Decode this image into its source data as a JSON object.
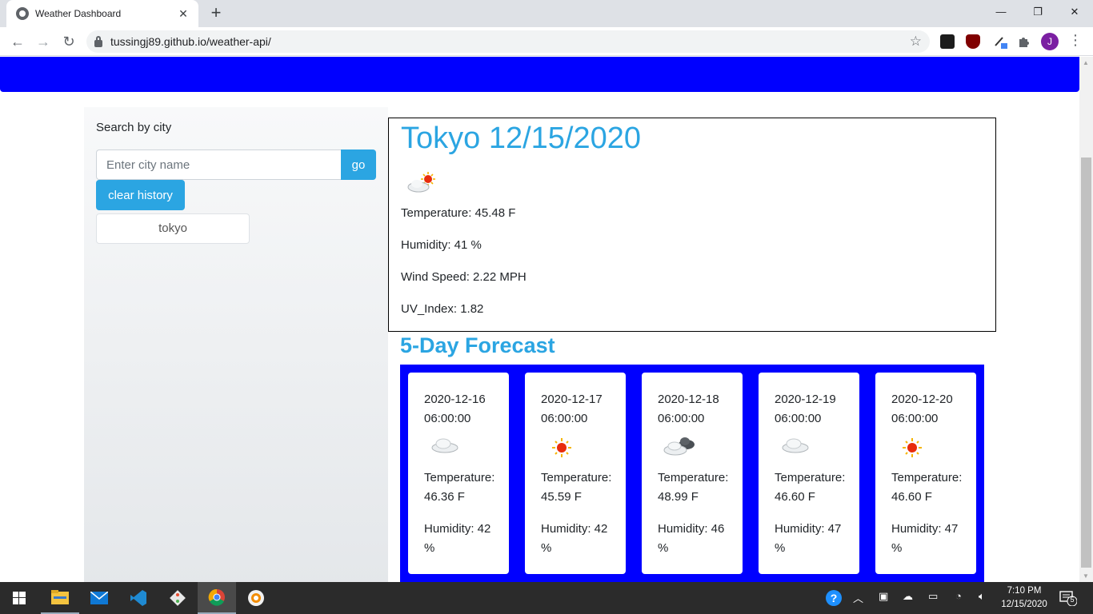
{
  "browser": {
    "tab_title": "Weather Dashboard",
    "url": "tussingj89.github.io/weather-api/",
    "profile_initial": "J"
  },
  "sidebar": {
    "search_label": "Search by city",
    "input_placeholder": "Enter city name",
    "input_value": "",
    "go_label": "go",
    "clear_label": "clear history",
    "history": [
      "tokyo"
    ]
  },
  "current": {
    "title": "Tokyo 12/15/2020",
    "icon": "sun-behind-cloud-icon",
    "temperature": "Temperature: 45.48 F",
    "humidity": "Humidity: 41 %",
    "wind": "Wind Speed: 2.22 MPH",
    "uv": "UV_Index: 1.82"
  },
  "forecast": {
    "title": "5-Day Forecast",
    "days": [
      {
        "date": "2020-12-16 06:00:00",
        "icon": "cloud-icon",
        "temp": "Temperature: 46.36 F",
        "humidity": "Humidity: 42 %"
      },
      {
        "date": "2020-12-17 06:00:00",
        "icon": "sun-icon",
        "temp": "Temperature: 45.59 F",
        "humidity": "Humidity: 42 %"
      },
      {
        "date": "2020-12-18 06:00:00",
        "icon": "dark-cloud-icon",
        "temp": "Temperature: 48.99 F",
        "humidity": "Humidity: 46 %"
      },
      {
        "date": "2020-12-19 06:00:00",
        "icon": "cloud-icon",
        "temp": "Temperature: 46.60 F",
        "humidity": "Humidity: 47 %"
      },
      {
        "date": "2020-12-20 06:00:00",
        "icon": "sun-icon",
        "temp": "Temperature: 46.60 F",
        "humidity": "Humidity: 47 %"
      }
    ]
  },
  "taskbar": {
    "time": "7:10 PM",
    "date": "12/15/2020",
    "notification_count": "5"
  },
  "colors": {
    "header_band": "#0000ff",
    "accent": "#2ba5e2"
  }
}
